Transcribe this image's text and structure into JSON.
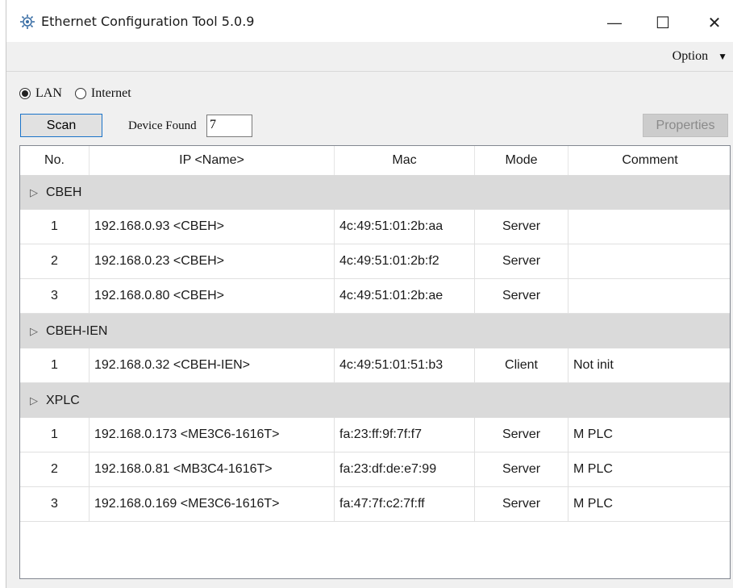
{
  "window": {
    "title": "Ethernet Configuration Tool 5.0.9"
  },
  "controls": {
    "minimize": "—",
    "maximize": "☐",
    "close": "✕"
  },
  "menu": {
    "option_label": "Option",
    "option_arrow": "▼"
  },
  "network": {
    "lan_label": "LAN",
    "internet_label": "Internet",
    "selected": "LAN"
  },
  "toolbar": {
    "scan_label": "Scan",
    "device_found_label": "Device Found",
    "device_found_value": "7",
    "properties_label": "Properties"
  },
  "table": {
    "columns": [
      "No.",
      "IP <Name>",
      "Mac",
      "Mode",
      "Comment"
    ],
    "groups": [
      {
        "name": "CBEH",
        "rows": [
          {
            "no": "1",
            "ip": "192.168.0.93 <CBEH>",
            "mac": "4c:49:51:01:2b:aa",
            "mode": "Server",
            "comment": ""
          },
          {
            "no": "2",
            "ip": "192.168.0.23 <CBEH>",
            "mac": "4c:49:51:01:2b:f2",
            "mode": "Server",
            "comment": ""
          },
          {
            "no": "3",
            "ip": "192.168.0.80 <CBEH>",
            "mac": "4c:49:51:01:2b:ae",
            "mode": "Server",
            "comment": ""
          }
        ]
      },
      {
        "name": "CBEH-IEN",
        "rows": [
          {
            "no": "1",
            "ip": "192.168.0.32 <CBEH-IEN>",
            "mac": "4c:49:51:01:51:b3",
            "mode": "Client",
            "comment": "Not init"
          }
        ]
      },
      {
        "name": "XPLC",
        "rows": [
          {
            "no": "1",
            "ip": "192.168.0.173 <ME3C6-1616T>",
            "mac": "fa:23:ff:9f:7f:f7",
            "mode": "Server",
            "comment": "M PLC"
          },
          {
            "no": "2",
            "ip": "192.168.0.81 <MB3C4-1616T>",
            "mac": "fa:23:df:de:e7:99",
            "mode": "Server",
            "comment": "M PLC"
          },
          {
            "no": "3",
            "ip": "192.168.0.169 <ME3C6-1616T>",
            "mac": "fa:47:7f:c2:7f:ff",
            "mode": "Server",
            "comment": "M PLC"
          }
        ]
      }
    ]
  },
  "colors": {
    "selected_border": "#1a73c9",
    "group_bg": "#dadada",
    "window_bg": "#f0f0f0"
  }
}
